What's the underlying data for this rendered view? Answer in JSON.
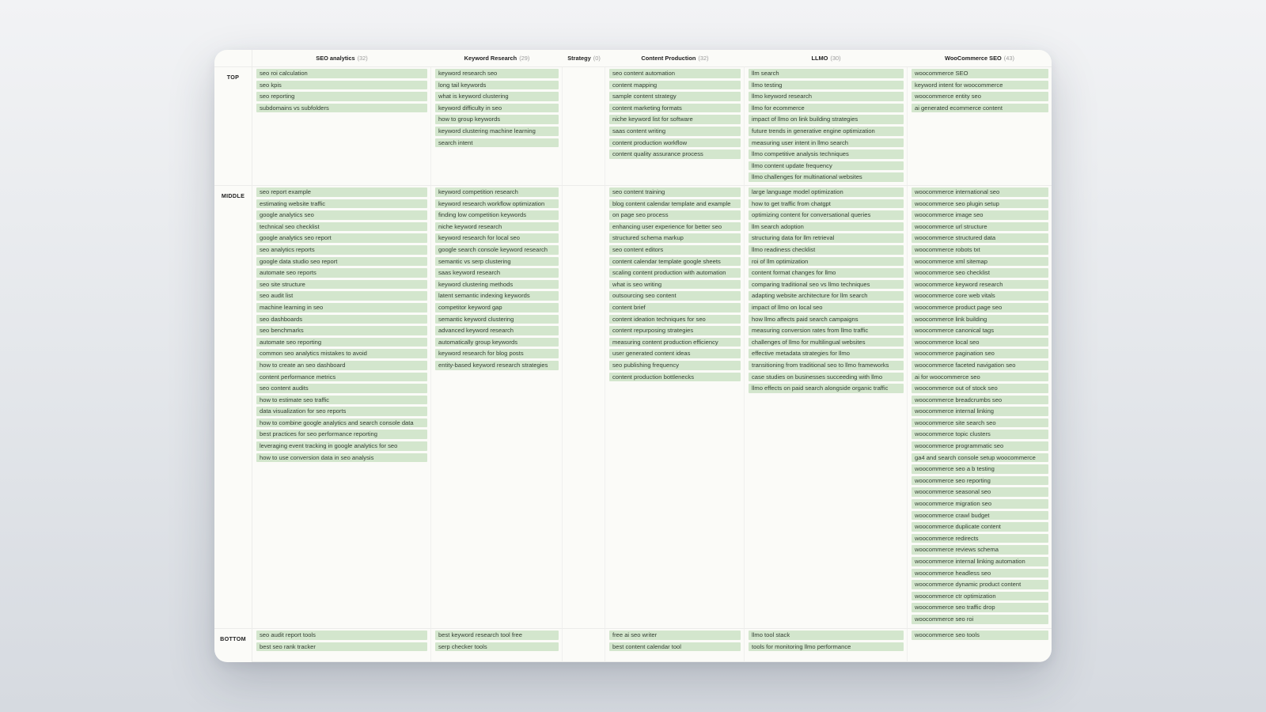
{
  "columns": [
    {
      "title": "SEO analytics",
      "count": "(32)"
    },
    {
      "title": "Keyword Research",
      "count": "(29)"
    },
    {
      "title": "Strategy",
      "count": "(0)"
    },
    {
      "title": "Content Production",
      "count": "(32)"
    },
    {
      "title": "LLMO",
      "count": "(30)"
    },
    {
      "title": "WooCommerce SEO",
      "count": "(43)"
    }
  ],
  "rows": [
    "TOP",
    "MIDDLE",
    "BOTTOM"
  ],
  "cells": {
    "top": [
      [
        "seo roi calculation",
        "seo kpis",
        "seo reporting",
        "subdomains vs subfolders"
      ],
      [
        "keyword research seo",
        "long tail keywords",
        "what is keyword clustering",
        "keyword difficulty in seo",
        "how to group keywords",
        "keyword clustering machine learning",
        "search intent"
      ],
      [],
      [
        "seo content automation",
        "content mapping",
        "sample content strategy",
        "content marketing formats",
        "niche keyword list for software",
        "saas content writing",
        "content production workflow",
        "content quality assurance process"
      ],
      [
        "llm search",
        "llmo testing",
        "llmo keyword research",
        "llmo for ecommerce",
        "impact of llmo on link building strategies",
        "future trends in generative engine optimization",
        "measuring user intent in llmo search",
        "llmo competitive analysis techniques",
        "llmo content update frequency",
        "llmo challenges for multinational websites"
      ],
      [
        "woocommerce SEO",
        "keyword intent for woocommerce",
        "woocommerce entity seo",
        "ai generated ecommerce content"
      ]
    ],
    "middle": [
      [
        "seo report example",
        "estimating website traffic",
        "google analytics seo",
        "technical seo checklist",
        "google analytics seo report",
        "seo analytics reports",
        "google data studio seo report",
        "automate seo reports",
        "seo site structure",
        "seo audit list",
        "machine learning in seo",
        "seo dashboards",
        "seo benchmarks",
        "automate seo reporting",
        "common seo analytics mistakes to avoid",
        "how to create an seo dashboard",
        "content performance metrics",
        "seo content audits",
        "how to estimate seo traffic",
        "data visualization for seo reports",
        "how to combine google analytics and search console data",
        "best practices for seo performance reporting",
        "leveraging event tracking in google analytics for seo",
        "how to use conversion data in seo analysis"
      ],
      [
        "keyword competition research",
        "keyword research workflow optimization",
        "finding low competition keywords",
        "niche keyword research",
        "keyword research for local seo",
        "google search console keyword research",
        "semantic vs serp clustering",
        "saas keyword research",
        "keyword clustering methods",
        "latent semantic indexing keywords",
        "competitor keyword gap",
        "semantic keyword clustering",
        "advanced keyword research",
        "automatically group keywords",
        "keyword research for blog posts",
        "entity-based keyword research strategies"
      ],
      [],
      [
        "seo content training",
        "blog content calendar template and example",
        "on page seo process",
        "enhancing user experience for better seo",
        "structured schema markup",
        "seo content editors",
        "content calendar template google sheets",
        "scaling content production with automation",
        "what is seo writing",
        "outsourcing seo content",
        "content brief",
        "content ideation techniques for seo",
        "content repurposing strategies",
        "measuring content production efficiency",
        "user generated content ideas",
        "seo publishing frequency",
        "content production bottlenecks"
      ],
      [
        "large language model optimization",
        "how to get traffic from chatgpt",
        "optimizing content for conversational queries",
        "llm search adoption",
        "structuring data for llm retrieval",
        "llmo readiness checklist",
        "roi of llm optimization",
        "content format changes for llmo",
        "comparing traditional seo vs llmo techniques",
        "adapting website architecture for llm search",
        "impact of llmo on local seo",
        "how llmo affects paid search campaigns",
        "measuring conversion rates from llmo traffic",
        "challenges of llmo for multilingual websites",
        "effective metadata strategies for llmo",
        "transitioning from traditional seo to llmo frameworks",
        "case studies on businesses succeeding with llmo",
        "llmo effects on paid search alongside organic traffic"
      ],
      [
        "woocommerce international seo",
        "woocommerce seo plugin setup",
        "woocommerce image seo",
        "woocommerce url structure",
        "woocommerce structured data",
        "woocommerce robots txt",
        "woocommerce xml sitemap",
        "woocommerce seo checklist",
        "woocommerce keyword research",
        "woocommerce core web vitals",
        "woocommerce product page seo",
        "woocommerce link building",
        "woocommerce canonical tags",
        "woocommerce local seo",
        "woocommerce pagination seo",
        "woocommerce faceted navigation seo",
        "ai for woocommerce seo",
        "woocommerce out of stock seo",
        "woocommerce breadcrumbs seo",
        "woocommerce internal linking",
        "woocommerce site search seo",
        "woocommerce topic clusters",
        "woocommerce programmatic seo",
        "ga4 and search console setup woocommerce",
        "woocommerce seo a b testing",
        "woocommerce seo reporting",
        "woocommerce seasonal seo",
        "woocommerce migration seo",
        "woocommerce crawl budget",
        "woocommerce duplicate content",
        "woocommerce redirects",
        "woocommerce reviews schema",
        "woocommerce internal linking automation",
        "woocommerce headless seo",
        "woocommerce dynamic product content",
        "woocommerce ctr optimization",
        "woocommerce seo traffic drop",
        "woocommerce seo roi"
      ]
    ],
    "bottom": [
      [
        "seo audit report tools",
        "best seo rank tracker"
      ],
      [
        "best keyword research tool free",
        "serp checker tools"
      ],
      [],
      [
        "free ai seo writer",
        "best content calendar tool"
      ],
      [
        "llmo tool stack",
        "tools for monitoring llmo performance"
      ],
      [
        "woocommerce seo tools"
      ]
    ]
  },
  "colors": {
    "chip_bg": "#d3e6cd",
    "chip_text": "#333f33",
    "card_bg": "#fbfbf8"
  }
}
